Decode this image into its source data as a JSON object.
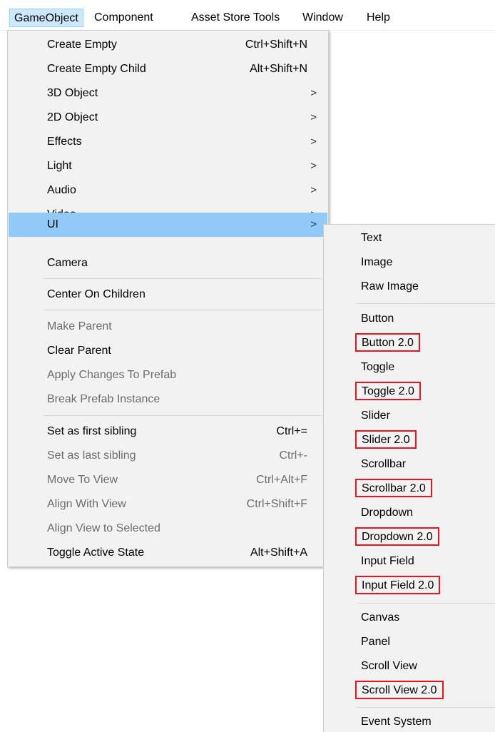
{
  "menubar": {
    "items": [
      "GameObject",
      "Component",
      "Asset Store Tools",
      "Window",
      "Help"
    ]
  },
  "main_menu": {
    "items": [
      {
        "label": "Create Empty",
        "shortcut": "Ctrl+Shift+N"
      },
      {
        "label": "Create Empty Child",
        "shortcut": "Alt+Shift+N"
      },
      {
        "label": "3D Object",
        "arrow": ">"
      },
      {
        "label": "2D Object",
        "arrow": ">"
      },
      {
        "label": "Effects",
        "arrow": ">"
      },
      {
        "label": "Light",
        "arrow": ">"
      },
      {
        "label": "Audio",
        "arrow": ">"
      },
      {
        "label": "Video",
        "arrow": ">"
      },
      {
        "label": "UI",
        "arrow": ">"
      },
      {
        "label": "Camera"
      },
      {
        "label": "Center On Children"
      },
      {
        "label": "Make Parent"
      },
      {
        "label": "Clear Parent"
      },
      {
        "label": "Apply Changes To Prefab"
      },
      {
        "label": "Break Prefab Instance"
      },
      {
        "label": "Set as first sibling",
        "shortcut": "Ctrl+="
      },
      {
        "label": "Set as last sibling",
        "shortcut": "Ctrl+-"
      },
      {
        "label": "Move To View",
        "shortcut": "Ctrl+Alt+F"
      },
      {
        "label": "Align With View",
        "shortcut": "Ctrl+Shift+F"
      },
      {
        "label": "Align View to Selected"
      },
      {
        "label": "Toggle Active State",
        "shortcut": "Alt+Shift+A"
      }
    ]
  },
  "ui_submenu": {
    "items": [
      "Text",
      "Image",
      "Raw Image",
      "Button",
      "Button 2.0",
      "Toggle",
      "Toggle 2.0",
      "Slider",
      "Slider 2.0",
      "Scrollbar",
      "Scrollbar 2.0",
      "Dropdown",
      "Dropdown 2.0",
      "Input Field",
      "Input Field 2.0",
      "Canvas",
      "Panel",
      "Scroll View",
      "Scroll View 2.0",
      "Event System"
    ]
  },
  "colors": {
    "highlight": "#91c9f7",
    "annotation_box": "#e8141f",
    "disabled_text": "#6d6d6d"
  }
}
